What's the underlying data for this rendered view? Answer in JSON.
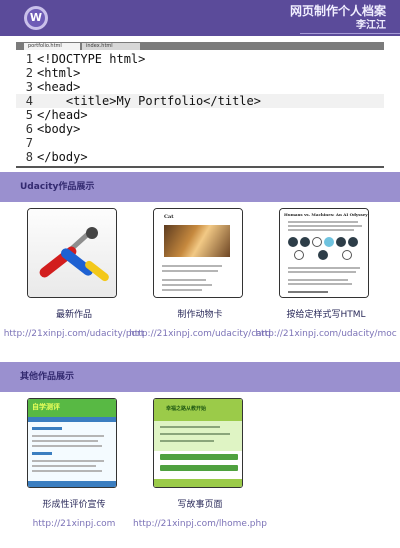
{
  "header": {
    "logo_letter": "W",
    "title": "网页制作个人档案",
    "author": "李江江"
  },
  "editor": {
    "tabs": [
      "portfolio.html",
      "index.html"
    ],
    "lines": [
      {
        "n": "1",
        "code": "<!DOCTYPE html>"
      },
      {
        "n": "2",
        "code": "<html>"
      },
      {
        "n": "3",
        "code": "<head>"
      },
      {
        "n": "4",
        "code": "    <title>My Portfolio</title>"
      },
      {
        "n": "5",
        "code": "</head>"
      },
      {
        "n": "6",
        "code": "<body>"
      },
      {
        "n": "7",
        "code": ""
      },
      {
        "n": "8",
        "code": "</body>"
      }
    ]
  },
  "sections": [
    {
      "title": "Udacity作品展示",
      "cards": [
        {
          "icon": "tools-thumbnail-icon",
          "title": "最新作品",
          "link": "http://21xinpj.com/udacity/port"
        },
        {
          "icon": "cat-card-thumbnail-icon",
          "title": "制作动物卡",
          "link": "http://21xinpj.com/udacity/card"
        },
        {
          "icon": "html-doc-thumbnail-icon",
          "title": "按给定样式写HTML",
          "link": "http://21xinpj.com/udacity/moc"
        }
      ]
    },
    {
      "title": "其他作品展示",
      "cards": [
        {
          "icon": "evaluation-thumbnail-icon",
          "title": "形成性评价宣传",
          "link": "http://21xinpj.com"
        },
        {
          "icon": "story-thumbnail-icon",
          "title": "写故事页面",
          "link": "http://21xinpj.com/lhome.php"
        }
      ]
    }
  ],
  "thumb_text": {
    "cat_heading": "Cat",
    "html_heading": "Humans vs. Machines: An AI Odyssey",
    "eval_heading": "自学测评",
    "story_heading": "幸福之路从教开始"
  },
  "colors": {
    "header": "#5b4b9a",
    "section_bar": "#9a90cf",
    "link": "#7c73b7"
  }
}
